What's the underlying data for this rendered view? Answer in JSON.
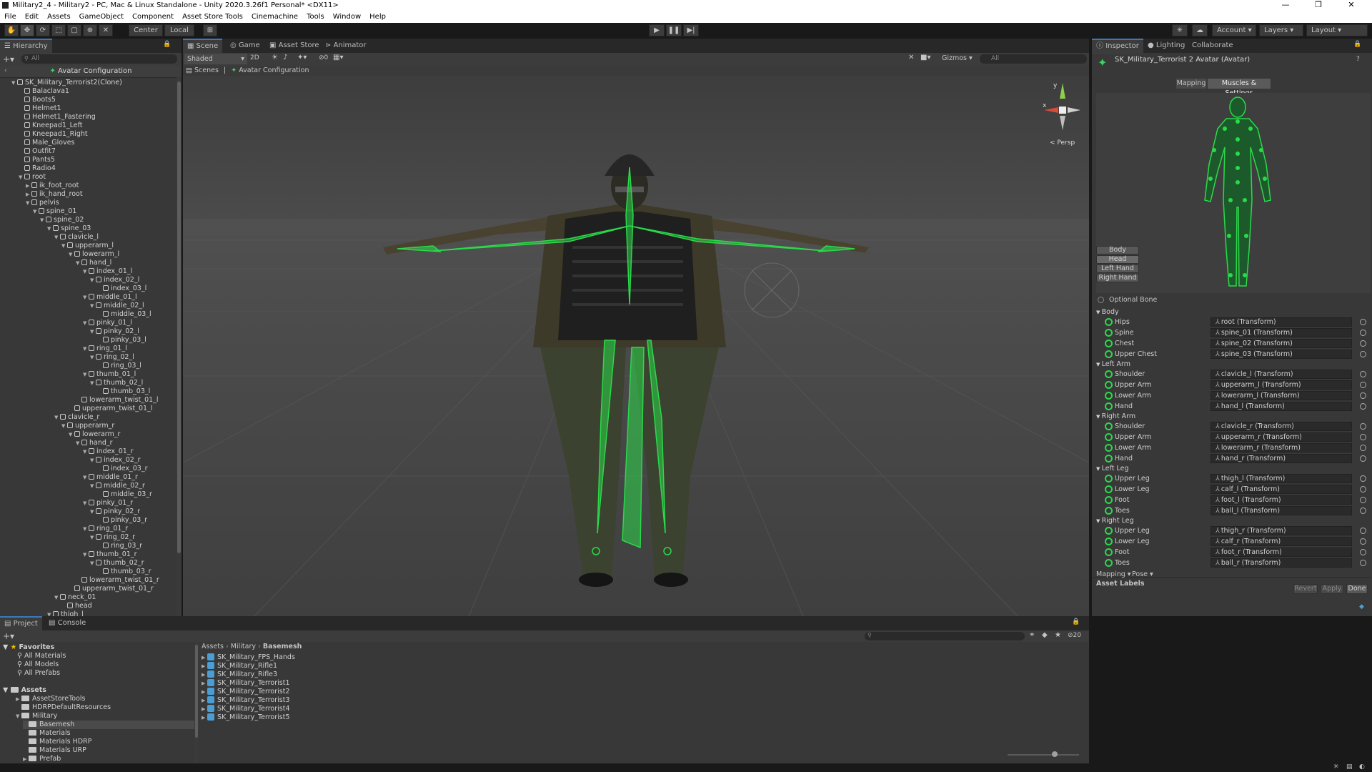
{
  "window": {
    "title": "Military2_4 - Military2 - PC, Mac & Linux Standalone - Unity 2020.3.26f1 Personal* <DX11>",
    "minimize": "—",
    "maximize": "❐",
    "close": "✕"
  },
  "menu": [
    "File",
    "Edit",
    "Assets",
    "GameObject",
    "Component",
    "Asset Store Tools",
    "Cinemachine",
    "Tools",
    "Window",
    "Help"
  ],
  "toolbar": {
    "pivot": "Center",
    "space": "Local",
    "account": "Account",
    "layers": "Layers",
    "layout": "Layout"
  },
  "hierarchy": {
    "tab": "Hierarchy",
    "search_placeholder": "All",
    "header": "Avatar Configuration",
    "items": [
      {
        "label": "SK_Military_Terrorist2(Clone)",
        "depth": 0,
        "arrow": "▼"
      },
      {
        "label": "Balaclava1",
        "depth": 1,
        "arrow": ""
      },
      {
        "label": "Boots5",
        "depth": 1,
        "arrow": ""
      },
      {
        "label": "Helmet1",
        "depth": 1,
        "arrow": ""
      },
      {
        "label": "Helmet1_Fastering",
        "depth": 1,
        "arrow": ""
      },
      {
        "label": "Kneepad1_Left",
        "depth": 1,
        "arrow": ""
      },
      {
        "label": "Kneepad1_Right",
        "depth": 1,
        "arrow": ""
      },
      {
        "label": "Male_Gloves",
        "depth": 1,
        "arrow": ""
      },
      {
        "label": "Outfit7",
        "depth": 1,
        "arrow": ""
      },
      {
        "label": "Pants5",
        "depth": 1,
        "arrow": ""
      },
      {
        "label": "Radio4",
        "depth": 1,
        "arrow": ""
      },
      {
        "label": "root",
        "depth": 1,
        "arrow": "▼"
      },
      {
        "label": "ik_foot_root",
        "depth": 2,
        "arrow": "▶"
      },
      {
        "label": "ik_hand_root",
        "depth": 2,
        "arrow": "▶"
      },
      {
        "label": "pelvis",
        "depth": 2,
        "arrow": "▼"
      },
      {
        "label": "spine_01",
        "depth": 3,
        "arrow": "▼"
      },
      {
        "label": "spine_02",
        "depth": 4,
        "arrow": "▼"
      },
      {
        "label": "spine_03",
        "depth": 5,
        "arrow": "▼"
      },
      {
        "label": "clavicle_l",
        "depth": 6,
        "arrow": "▼"
      },
      {
        "label": "upperarm_l",
        "depth": 7,
        "arrow": "▼"
      },
      {
        "label": "lowerarm_l",
        "depth": 8,
        "arrow": "▼"
      },
      {
        "label": "hand_l",
        "depth": 9,
        "arrow": "▼"
      },
      {
        "label": "index_01_l",
        "depth": 10,
        "arrow": "▼"
      },
      {
        "label": "index_02_l",
        "depth": 11,
        "arrow": "▼"
      },
      {
        "label": "index_03_l",
        "depth": 12,
        "arrow": ""
      },
      {
        "label": "middle_01_l",
        "depth": 10,
        "arrow": "▼"
      },
      {
        "label": "middle_02_l",
        "depth": 11,
        "arrow": "▼"
      },
      {
        "label": "middle_03_l",
        "depth": 12,
        "arrow": ""
      },
      {
        "label": "pinky_01_l",
        "depth": 10,
        "arrow": "▼"
      },
      {
        "label": "pinky_02_l",
        "depth": 11,
        "arrow": "▼"
      },
      {
        "label": "pinky_03_l",
        "depth": 12,
        "arrow": ""
      },
      {
        "label": "ring_01_l",
        "depth": 10,
        "arrow": "▼"
      },
      {
        "label": "ring_02_l",
        "depth": 11,
        "arrow": "▼"
      },
      {
        "label": "ring_03_l",
        "depth": 12,
        "arrow": ""
      },
      {
        "label": "thumb_01_l",
        "depth": 10,
        "arrow": "▼"
      },
      {
        "label": "thumb_02_l",
        "depth": 11,
        "arrow": "▼"
      },
      {
        "label": "thumb_03_l",
        "depth": 12,
        "arrow": ""
      },
      {
        "label": "lowerarm_twist_01_l",
        "depth": 9,
        "arrow": ""
      },
      {
        "label": "upperarm_twist_01_l",
        "depth": 8,
        "arrow": ""
      },
      {
        "label": "clavicle_r",
        "depth": 6,
        "arrow": "▼"
      },
      {
        "label": "upperarm_r",
        "depth": 7,
        "arrow": "▼"
      },
      {
        "label": "lowerarm_r",
        "depth": 8,
        "arrow": "▼"
      },
      {
        "label": "hand_r",
        "depth": 9,
        "arrow": "▼"
      },
      {
        "label": "index_01_r",
        "depth": 10,
        "arrow": "▼"
      },
      {
        "label": "index_02_r",
        "depth": 11,
        "arrow": "▼"
      },
      {
        "label": "index_03_r",
        "depth": 12,
        "arrow": ""
      },
      {
        "label": "middle_01_r",
        "depth": 10,
        "arrow": "▼"
      },
      {
        "label": "middle_02_r",
        "depth": 11,
        "arrow": "▼"
      },
      {
        "label": "middle_03_r",
        "depth": 12,
        "arrow": ""
      },
      {
        "label": "pinky_01_r",
        "depth": 10,
        "arrow": "▼"
      },
      {
        "label": "pinky_02_r",
        "depth": 11,
        "arrow": "▼"
      },
      {
        "label": "pinky_03_r",
        "depth": 12,
        "arrow": ""
      },
      {
        "label": "ring_01_r",
        "depth": 10,
        "arrow": "▼"
      },
      {
        "label": "ring_02_r",
        "depth": 11,
        "arrow": "▼"
      },
      {
        "label": "ring_03_r",
        "depth": 12,
        "arrow": ""
      },
      {
        "label": "thumb_01_r",
        "depth": 10,
        "arrow": "▼"
      },
      {
        "label": "thumb_02_r",
        "depth": 11,
        "arrow": "▼"
      },
      {
        "label": "thumb_03_r",
        "depth": 12,
        "arrow": ""
      },
      {
        "label": "lowerarm_twist_01_r",
        "depth": 9,
        "arrow": ""
      },
      {
        "label": "upperarm_twist_01_r",
        "depth": 8,
        "arrow": ""
      },
      {
        "label": "neck_01",
        "depth": 6,
        "arrow": "▼"
      },
      {
        "label": "head",
        "depth": 7,
        "arrow": ""
      },
      {
        "label": "thigh_l",
        "depth": 5,
        "arrow": "▼"
      }
    ]
  },
  "scene": {
    "tabs": [
      "Scene",
      "Game",
      "Asset Store",
      "Animator"
    ],
    "shading": "Shaded",
    "mode_2d": "2D",
    "hidden_count": "0",
    "gizmos": "Gizmos",
    "search_placeholder": "All",
    "breadcrumb_root": "Scenes",
    "breadcrumb_current": "Avatar Configuration",
    "persp": "Persp",
    "axis_x": "x",
    "axis_y": "y"
  },
  "inspector": {
    "tabs": [
      "Inspector",
      "Lighting",
      "Collaborate"
    ],
    "object_title": "SK_Military_Terrorist 2 Avatar (Avatar)",
    "subtabs": [
      "Mapping",
      "Muscles & Settings"
    ],
    "body_buttons": [
      "Body",
      "Head",
      "Left Hand",
      "Right Hand"
    ],
    "optional_bone": "Optional Bone",
    "groups": [
      {
        "name": "Body",
        "bones": [
          [
            "Hips",
            "root (Transform)"
          ],
          [
            "Spine",
            "spine_01 (Transform)"
          ],
          [
            "Chest",
            "spine_02 (Transform)"
          ],
          [
            "Upper Chest",
            "spine_03 (Transform)"
          ]
        ]
      },
      {
        "name": "Left Arm",
        "bones": [
          [
            "Shoulder",
            "clavicle_l (Transform)"
          ],
          [
            "Upper Arm",
            "upperarm_l (Transform)"
          ],
          [
            "Lower Arm",
            "lowerarm_l (Transform)"
          ],
          [
            "Hand",
            "hand_l (Transform)"
          ]
        ]
      },
      {
        "name": "Right Arm",
        "bones": [
          [
            "Shoulder",
            "clavicle_r (Transform)"
          ],
          [
            "Upper Arm",
            "upperarm_r (Transform)"
          ],
          [
            "Lower Arm",
            "lowerarm_r (Transform)"
          ],
          [
            "Hand",
            "hand_r (Transform)"
          ]
        ]
      },
      {
        "name": "Left Leg",
        "bones": [
          [
            "Upper Leg",
            "thigh_l (Transform)"
          ],
          [
            "Lower Leg",
            "calf_l (Transform)"
          ],
          [
            "Foot",
            "foot_l (Transform)"
          ],
          [
            "Toes",
            "ball_l (Transform)"
          ]
        ]
      },
      {
        "name": "Right Leg",
        "bones": [
          [
            "Upper Leg",
            "thigh_r (Transform)"
          ],
          [
            "Lower Leg",
            "calf_r (Transform)"
          ],
          [
            "Foot",
            "foot_r (Transform)"
          ],
          [
            "Toes",
            "ball_r (Transform)"
          ]
        ]
      }
    ],
    "mapping_dropdown": "Mapping",
    "pose_dropdown": "Pose",
    "revert": "Revert",
    "apply": "Apply",
    "done": "Done",
    "asset_labels": "Asset Labels"
  },
  "project": {
    "tabs": [
      "Project",
      "Console"
    ],
    "favorites": "Favorites",
    "favorite_items": [
      "All Materials",
      "All Models",
      "All Prefabs"
    ],
    "assets_root": "Assets",
    "asset_folders": [
      {
        "label": "AssetStoreTools",
        "depth": 1,
        "arrow": "▶"
      },
      {
        "label": "HDRPDefaultResources",
        "depth": 1,
        "arrow": ""
      },
      {
        "label": "Military",
        "depth": 1,
        "arrow": "▼"
      },
      {
        "label": "Basemesh",
        "depth": 2,
        "arrow": "",
        "selected": true
      },
      {
        "label": "Materials",
        "depth": 2,
        "arrow": ""
      },
      {
        "label": "Materials HDRP",
        "depth": 2,
        "arrow": ""
      },
      {
        "label": "Materials URP",
        "depth": 2,
        "arrow": ""
      },
      {
        "label": "Prefab",
        "depth": 2,
        "arrow": "▶"
      }
    ],
    "breadcrumb": [
      "Assets",
      "Military",
      "Basemesh"
    ],
    "files": [
      "SK_Military_FPS_Hands",
      "SK_Military_Rifle1",
      "SK_Military_Rifle3",
      "SK_Military_Terrorist1",
      "SK_Military_Terrorist2",
      "SK_Military_Terrorist3",
      "SK_Military_Terrorist4",
      "SK_Military_Terrorist5"
    ],
    "hidden_count": "20"
  },
  "colors": {
    "accent": "#3a79bb",
    "bone_green": "#2bd94a",
    "panel": "#383838",
    "scene_bg": "#4a4a4a"
  }
}
